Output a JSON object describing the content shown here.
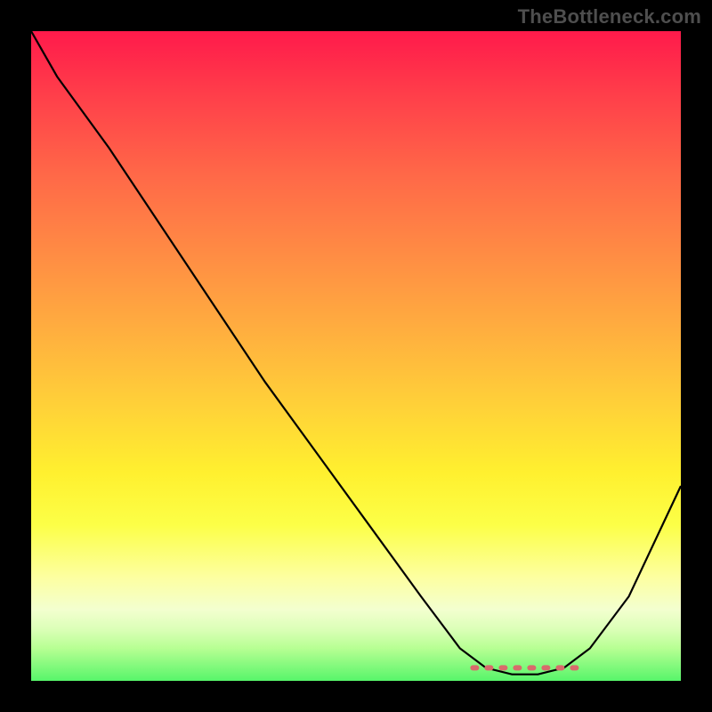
{
  "watermark": "TheBottleneck.com",
  "chart_data": {
    "type": "line",
    "title": "",
    "xlabel": "",
    "ylabel": "",
    "xlim": [
      0,
      100
    ],
    "ylim": [
      0,
      100
    ],
    "x": [
      0,
      4,
      12,
      20,
      28,
      36,
      44,
      52,
      60,
      66,
      70,
      74,
      78,
      82,
      86,
      92,
      100
    ],
    "values": [
      100,
      93,
      82,
      70,
      58,
      46,
      35,
      24,
      13,
      5,
      2,
      1,
      1,
      2,
      5,
      13,
      30
    ],
    "gradient_stops": [
      {
        "pos": 0,
        "color": "#ff1a4b"
      },
      {
        "pos": 22,
        "color": "#ff6848"
      },
      {
        "pos": 46,
        "color": "#ffae3f"
      },
      {
        "pos": 68,
        "color": "#fff02f"
      },
      {
        "pos": 84,
        "color": "#fdffa0"
      },
      {
        "pos": 100,
        "color": "#57f56a"
      }
    ],
    "valley_marker": {
      "x_start": 68,
      "x_end": 84,
      "y": 2,
      "color": "#d86b6b"
    }
  }
}
